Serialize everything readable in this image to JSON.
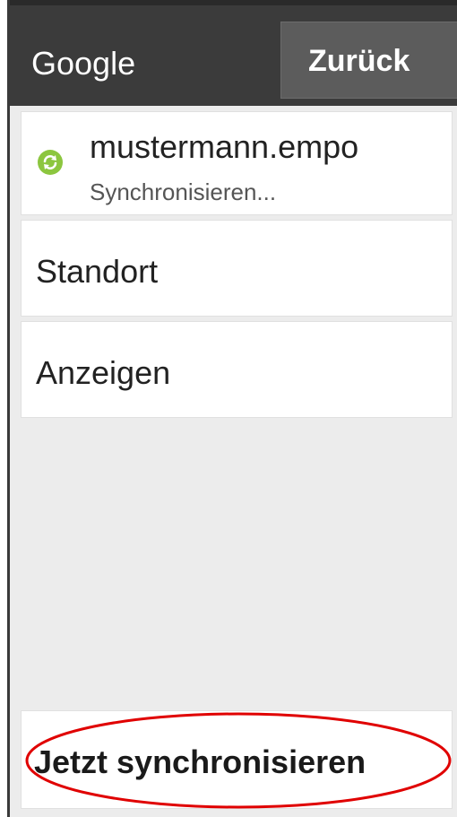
{
  "header": {
    "title": "Google",
    "back_label": "Zurück"
  },
  "account": {
    "name": "mustermann.empo",
    "status": "Synchronisieren...",
    "icon": "sync-icon",
    "icon_color": "#8cc63f"
  },
  "menu": {
    "standort": "Standort",
    "anzeigen": "Anzeigen"
  },
  "footer": {
    "sync_now_label": "Jetzt synchronisieren"
  },
  "annotation": {
    "ring_color": "#e00000"
  }
}
